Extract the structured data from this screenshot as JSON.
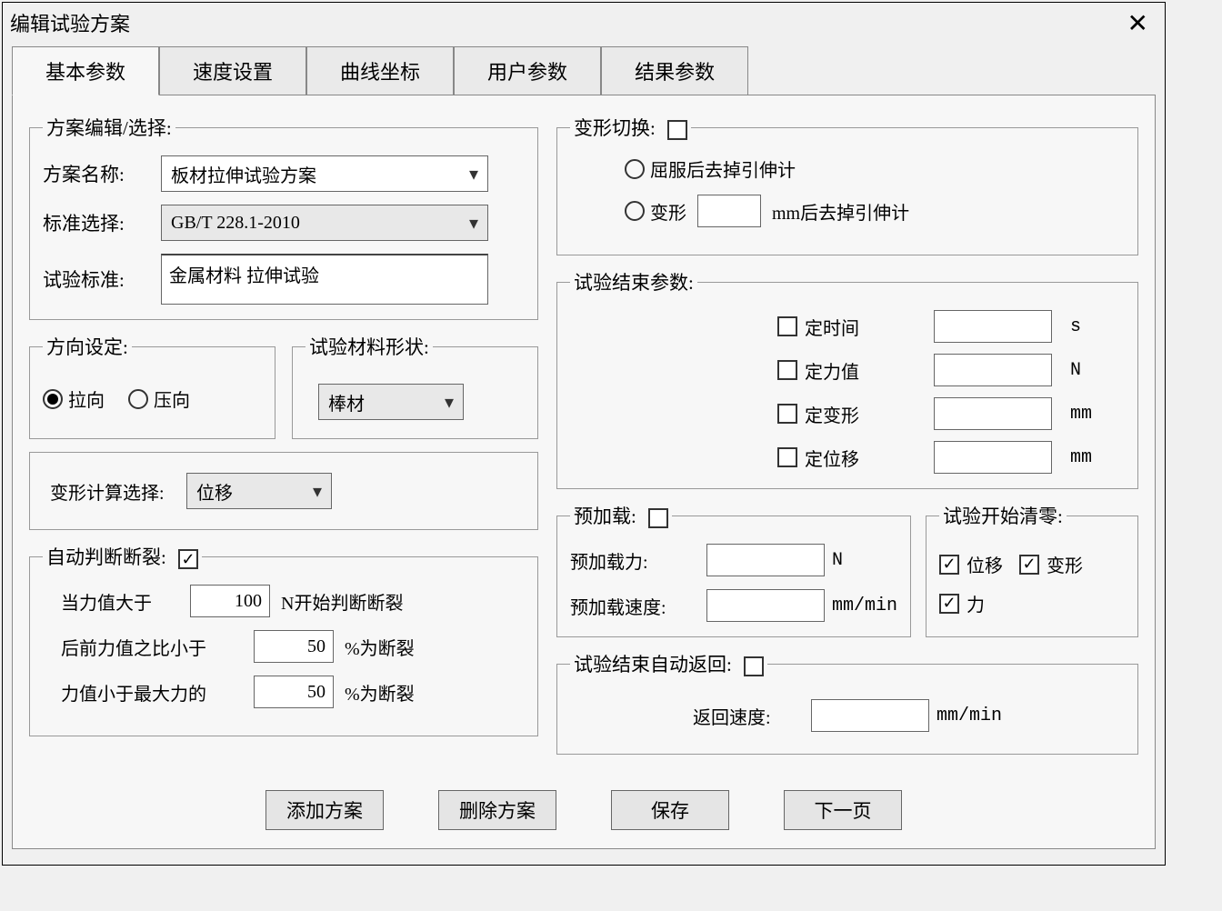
{
  "window": {
    "title": "编辑试验方案"
  },
  "tabs": {
    "basic": "基本参数",
    "speed": "速度设置",
    "curve": "曲线坐标",
    "user": "用户参数",
    "result": "结果参数"
  },
  "scheme": {
    "legend": "方案编辑/选择:",
    "name_label": "方案名称:",
    "name_value": "板材拉伸试验方案",
    "std_label": "标准选择:",
    "std_value": "GB/T 228.1-2010",
    "test_std_label": "试验标准:",
    "test_std_value": "金属材料 拉伸试验"
  },
  "direction": {
    "legend": "方向设定:",
    "opt_pull": "拉向",
    "opt_push": "压向"
  },
  "shape": {
    "legend": "试验材料形状:",
    "value": "棒材"
  },
  "calc": {
    "label": "变形计算选择:",
    "value": "位移"
  },
  "fracture": {
    "legend": "自动判断断裂:",
    "line1a": "当力值大于",
    "line1_val": "100",
    "line1b": "N开始判断断裂",
    "line2a": "后前力值之比小于",
    "line2_val": "50",
    "line2b": "%为断裂",
    "line3a": "力值小于最大力的",
    "line3_val": "50",
    "line3b": "%为断裂"
  },
  "deform_switch": {
    "legend": "变形切换:",
    "opt1": "屈服后去掉引伸计",
    "opt2a": "变形",
    "opt2b": "mm后去掉引伸计"
  },
  "end_params": {
    "legend": "试验结束参数:",
    "time": "定时间",
    "time_unit": "s",
    "force": "定力值",
    "force_unit": "N",
    "deform": "定变形",
    "deform_unit": "mm",
    "disp": "定位移",
    "disp_unit": "mm"
  },
  "preload": {
    "legend": "预加载:",
    "force_label": "预加载力:",
    "force_unit": "N",
    "speed_label": "预加载速度:",
    "speed_unit": "mm/min"
  },
  "zero": {
    "legend": "试验开始清零:",
    "disp": "位移",
    "deform": "变形",
    "force": "力"
  },
  "autoreturn": {
    "legend": "试验结束自动返回:",
    "speed_label": "返回速度:",
    "speed_unit": "mm/min"
  },
  "buttons": {
    "add": "添加方案",
    "delete": "删除方案",
    "save": "保存",
    "next": "下一页"
  }
}
